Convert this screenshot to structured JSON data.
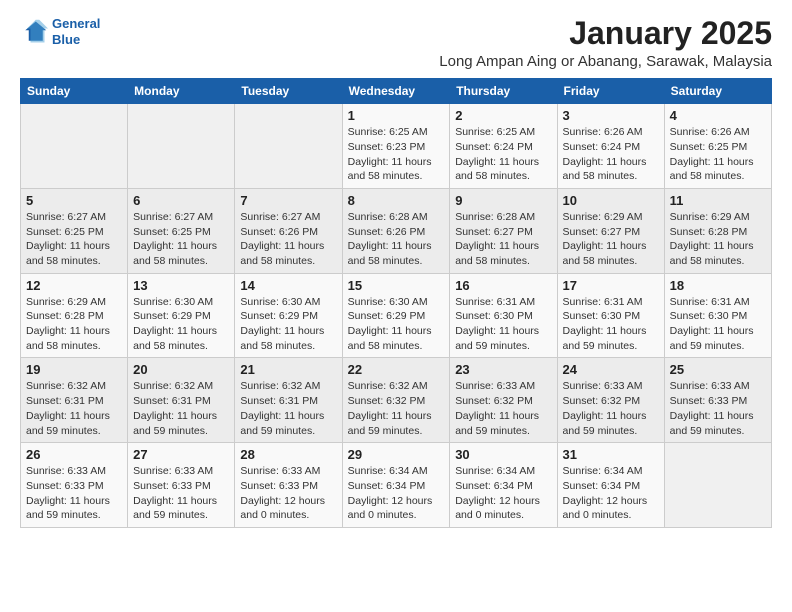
{
  "logo": {
    "line1": "General",
    "line2": "Blue"
  },
  "title": "January 2025",
  "subtitle": "Long Ampan Aing or Abanang, Sarawak, Malaysia",
  "weekdays": [
    "Sunday",
    "Monday",
    "Tuesday",
    "Wednesday",
    "Thursday",
    "Friday",
    "Saturday"
  ],
  "weeks": [
    [
      {
        "day": "",
        "info": ""
      },
      {
        "day": "",
        "info": ""
      },
      {
        "day": "",
        "info": ""
      },
      {
        "day": "1",
        "info": "Sunrise: 6:25 AM\nSunset: 6:23 PM\nDaylight: 11 hours\nand 58 minutes."
      },
      {
        "day": "2",
        "info": "Sunrise: 6:25 AM\nSunset: 6:24 PM\nDaylight: 11 hours\nand 58 minutes."
      },
      {
        "day": "3",
        "info": "Sunrise: 6:26 AM\nSunset: 6:24 PM\nDaylight: 11 hours\nand 58 minutes."
      },
      {
        "day": "4",
        "info": "Sunrise: 6:26 AM\nSunset: 6:25 PM\nDaylight: 11 hours\nand 58 minutes."
      }
    ],
    [
      {
        "day": "5",
        "info": "Sunrise: 6:27 AM\nSunset: 6:25 PM\nDaylight: 11 hours\nand 58 minutes."
      },
      {
        "day": "6",
        "info": "Sunrise: 6:27 AM\nSunset: 6:25 PM\nDaylight: 11 hours\nand 58 minutes."
      },
      {
        "day": "7",
        "info": "Sunrise: 6:27 AM\nSunset: 6:26 PM\nDaylight: 11 hours\nand 58 minutes."
      },
      {
        "day": "8",
        "info": "Sunrise: 6:28 AM\nSunset: 6:26 PM\nDaylight: 11 hours\nand 58 minutes."
      },
      {
        "day": "9",
        "info": "Sunrise: 6:28 AM\nSunset: 6:27 PM\nDaylight: 11 hours\nand 58 minutes."
      },
      {
        "day": "10",
        "info": "Sunrise: 6:29 AM\nSunset: 6:27 PM\nDaylight: 11 hours\nand 58 minutes."
      },
      {
        "day": "11",
        "info": "Sunrise: 6:29 AM\nSunset: 6:28 PM\nDaylight: 11 hours\nand 58 minutes."
      }
    ],
    [
      {
        "day": "12",
        "info": "Sunrise: 6:29 AM\nSunset: 6:28 PM\nDaylight: 11 hours\nand 58 minutes."
      },
      {
        "day": "13",
        "info": "Sunrise: 6:30 AM\nSunset: 6:29 PM\nDaylight: 11 hours\nand 58 minutes."
      },
      {
        "day": "14",
        "info": "Sunrise: 6:30 AM\nSunset: 6:29 PM\nDaylight: 11 hours\nand 58 minutes."
      },
      {
        "day": "15",
        "info": "Sunrise: 6:30 AM\nSunset: 6:29 PM\nDaylight: 11 hours\nand 58 minutes."
      },
      {
        "day": "16",
        "info": "Sunrise: 6:31 AM\nSunset: 6:30 PM\nDaylight: 11 hours\nand 59 minutes."
      },
      {
        "day": "17",
        "info": "Sunrise: 6:31 AM\nSunset: 6:30 PM\nDaylight: 11 hours\nand 59 minutes."
      },
      {
        "day": "18",
        "info": "Sunrise: 6:31 AM\nSunset: 6:30 PM\nDaylight: 11 hours\nand 59 minutes."
      }
    ],
    [
      {
        "day": "19",
        "info": "Sunrise: 6:32 AM\nSunset: 6:31 PM\nDaylight: 11 hours\nand 59 minutes."
      },
      {
        "day": "20",
        "info": "Sunrise: 6:32 AM\nSunset: 6:31 PM\nDaylight: 11 hours\nand 59 minutes."
      },
      {
        "day": "21",
        "info": "Sunrise: 6:32 AM\nSunset: 6:31 PM\nDaylight: 11 hours\nand 59 minutes."
      },
      {
        "day": "22",
        "info": "Sunrise: 6:32 AM\nSunset: 6:32 PM\nDaylight: 11 hours\nand 59 minutes."
      },
      {
        "day": "23",
        "info": "Sunrise: 6:33 AM\nSunset: 6:32 PM\nDaylight: 11 hours\nand 59 minutes."
      },
      {
        "day": "24",
        "info": "Sunrise: 6:33 AM\nSunset: 6:32 PM\nDaylight: 11 hours\nand 59 minutes."
      },
      {
        "day": "25",
        "info": "Sunrise: 6:33 AM\nSunset: 6:33 PM\nDaylight: 11 hours\nand 59 minutes."
      }
    ],
    [
      {
        "day": "26",
        "info": "Sunrise: 6:33 AM\nSunset: 6:33 PM\nDaylight: 11 hours\nand 59 minutes."
      },
      {
        "day": "27",
        "info": "Sunrise: 6:33 AM\nSunset: 6:33 PM\nDaylight: 11 hours\nand 59 minutes."
      },
      {
        "day": "28",
        "info": "Sunrise: 6:33 AM\nSunset: 6:33 PM\nDaylight: 12 hours\nand 0 minutes."
      },
      {
        "day": "29",
        "info": "Sunrise: 6:34 AM\nSunset: 6:34 PM\nDaylight: 12 hours\nand 0 minutes."
      },
      {
        "day": "30",
        "info": "Sunrise: 6:34 AM\nSunset: 6:34 PM\nDaylight: 12 hours\nand 0 minutes."
      },
      {
        "day": "31",
        "info": "Sunrise: 6:34 AM\nSunset: 6:34 PM\nDaylight: 12 hours\nand 0 minutes."
      },
      {
        "day": "",
        "info": ""
      }
    ]
  ]
}
